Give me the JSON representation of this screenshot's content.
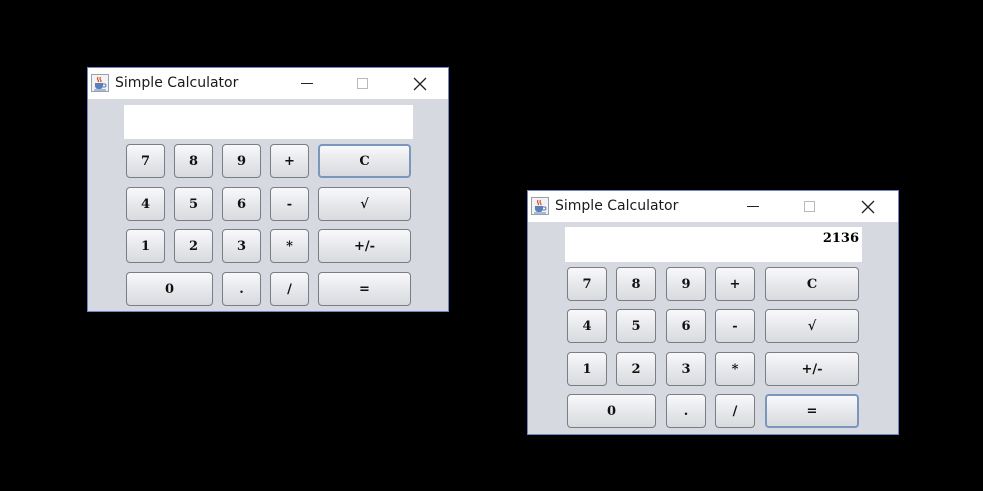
{
  "windows": [
    {
      "title": "Simple Calculator",
      "display_value": "",
      "buttons": {
        "seven": "7",
        "eight": "8",
        "nine": "9",
        "plus": "+",
        "clear": "C",
        "four": "4",
        "five": "5",
        "six": "6",
        "minus": "-",
        "sqrt": "√",
        "one": "1",
        "two": "2",
        "three": "3",
        "multiply": "*",
        "negate": "+/-",
        "zero": "0",
        "decimal": ".",
        "divide": "/",
        "equals": "="
      }
    },
    {
      "title": "Simple Calculator",
      "display_value": "2136",
      "buttons": {
        "seven": "7",
        "eight": "8",
        "nine": "9",
        "plus": "+",
        "clear": "C",
        "four": "4",
        "five": "5",
        "six": "6",
        "minus": "-",
        "sqrt": "√",
        "one": "1",
        "two": "2",
        "three": "3",
        "multiply": "*",
        "negate": "+/-",
        "zero": "0",
        "decimal": ".",
        "divide": "/",
        "equals": "="
      }
    }
  ],
  "icons": {
    "app": "java-coffee-cup-icon",
    "minimize": "minimize-icon",
    "maximize": "maximize-icon",
    "close": "close-icon"
  },
  "colors": {
    "background": "#000000",
    "window_body": "#d6d9e0",
    "window_border": "#6f87c7",
    "focus_ring": "#7b96bd"
  }
}
